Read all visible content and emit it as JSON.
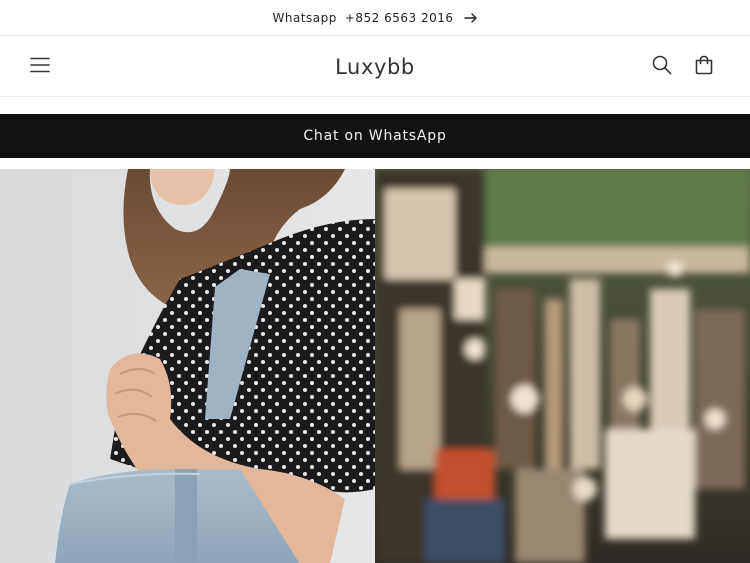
{
  "announcement": {
    "label": "Whatsapp",
    "phone": "+852 6563 2016",
    "arrow_icon": "arrow-right-icon"
  },
  "header": {
    "logo": "Luxybb",
    "menu_icon": "hamburger-menu-icon",
    "search_icon": "search-icon",
    "cart_icon": "cart-icon"
  },
  "whatsapp_bar": {
    "label": "Chat on WhatsApp",
    "background": "#121212"
  },
  "hero": {
    "left_image": "woman-with-blue-handbag-photo",
    "right_image": "blurred-jewelry-store-photo"
  }
}
